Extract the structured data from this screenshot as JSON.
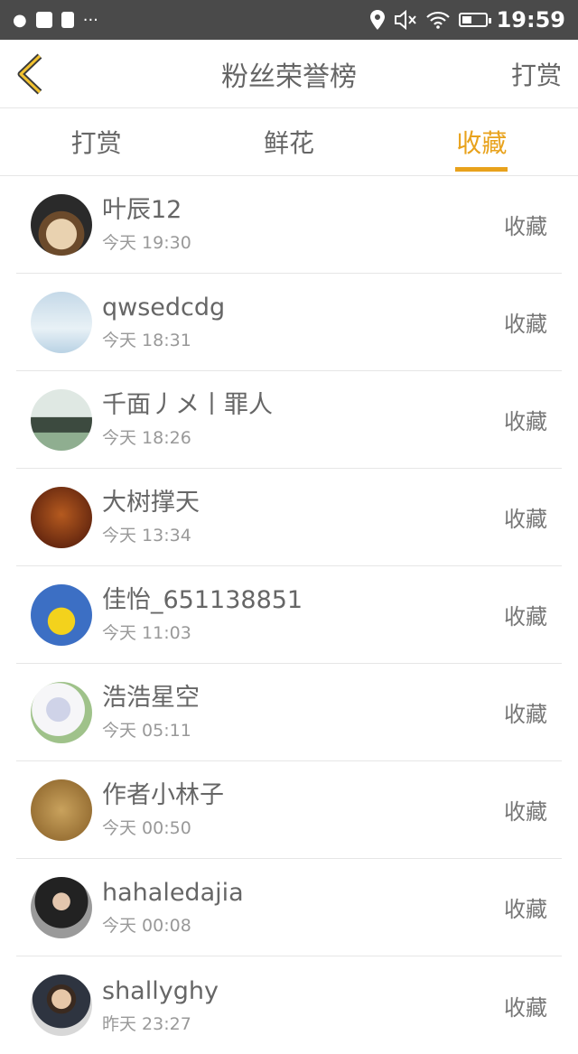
{
  "status_bar": {
    "time": "19:59",
    "dots": "···"
  },
  "header": {
    "title": "粉丝荣誉榜",
    "right_action": "打赏"
  },
  "tabs": [
    {
      "label": "打赏",
      "active": false
    },
    {
      "label": "鲜花",
      "active": false
    },
    {
      "label": "收藏",
      "active": true
    }
  ],
  "colors": {
    "accent": "#e8a21c",
    "status_bar": "#4a4a4a",
    "divider": "#e6e6e6"
  },
  "fans": [
    {
      "name": "叶辰12",
      "time": "今天 19:30",
      "action": "收藏"
    },
    {
      "name": "qwsedcdg",
      "time": "今天 18:31",
      "action": "收藏"
    },
    {
      "name": "千面丿メ丨罪人",
      "time": "今天 18:26",
      "action": "收藏"
    },
    {
      "name": "大树撑天",
      "time": "今天 13:34",
      "action": "收藏"
    },
    {
      "name": "佳怡_651138851",
      "time": "今天 11:03",
      "action": "收藏"
    },
    {
      "name": "浩浩星空",
      "time": "今天 05:11",
      "action": "收藏"
    },
    {
      "name": "作者小林子",
      "time": "今天 00:50",
      "action": "收藏"
    },
    {
      "name": "hahaledajia",
      "time": "今天 00:08",
      "action": "收藏"
    },
    {
      "name": "shallyghy",
      "time": "昨天 23:27",
      "action": "收藏"
    }
  ]
}
